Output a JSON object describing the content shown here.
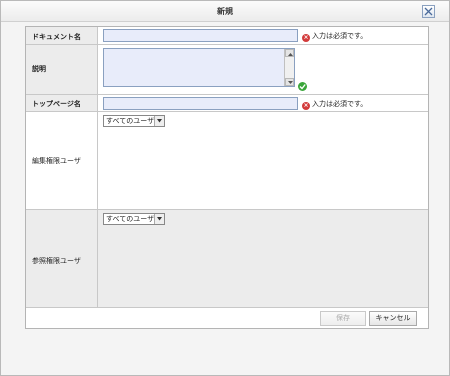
{
  "dialog": {
    "title": "新規"
  },
  "fields": {
    "document_name": {
      "label": "ドキュメント名",
      "value": "",
      "error": "入力は必須です。"
    },
    "description": {
      "label": "説明",
      "value": ""
    },
    "top_page_name": {
      "label": "トップページ名",
      "value": "",
      "error": "入力は必須です。"
    },
    "edit_permission": {
      "label": "編集権限ユーザ",
      "selected": "すべてのユーザ"
    },
    "view_permission": {
      "label": "参照権限ユーザ",
      "selected": "すべてのユーザ"
    }
  },
  "buttons": {
    "save": "保存",
    "cancel": "キャンセル"
  },
  "icons": {
    "close": "close-icon",
    "error": "error-icon",
    "valid": "check-icon",
    "dropdown": "chevron-down-icon"
  },
  "colors": {
    "error": "#d23b3b",
    "valid": "#3aa63a",
    "input_bg": "#e8ecfa"
  }
}
